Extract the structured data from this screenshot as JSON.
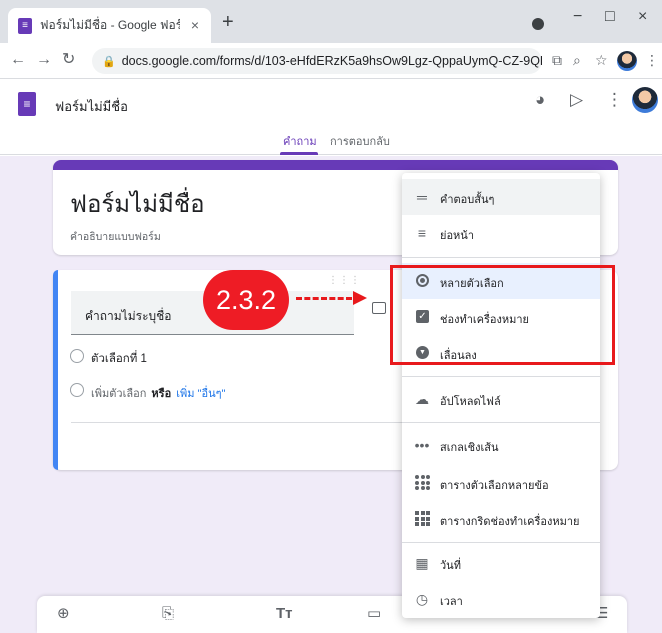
{
  "browser": {
    "tab_title": "ฟอร์มไม่มีชื่อ - Google ฟอร์ม",
    "tab_close": "×",
    "new_tab": "+",
    "url": "docs.google.com/forms/d/103-eHfdERzK5a9hsOw9Lgz-QppaUymQ-CZ-9QH9A...",
    "window_minimize": "−",
    "window_maximize": "□",
    "window_close": "×"
  },
  "app": {
    "form_name": "ฟอร์มไม่มีชื่อ",
    "tabs": [
      {
        "label": "คำถาม",
        "active": true
      },
      {
        "label": "การตอบกลับ",
        "active": false
      }
    ]
  },
  "form": {
    "title": "ฟอร์มไม่มีชื่อ",
    "description": "คำอธิบายแบบฟอร์ม"
  },
  "question": {
    "title": "คำถามไม่ระบุชื่อ",
    "option_1": "ตัวเลือกที่ 1",
    "add_option": "เพิ่มตัวเลือก",
    "or": "หรือ",
    "add_other": "เพิ่ม \"อื่นๆ\""
  },
  "menu": {
    "items": [
      {
        "label": "คำตอบสั้นๆ",
        "icon": "short-answer-icon"
      },
      {
        "label": "ย่อหน้า",
        "icon": "paragraph-icon"
      },
      {
        "label": "หลายตัวเลือก",
        "icon": "radio-icon"
      },
      {
        "label": "ช่องทำเครื่องหมาย",
        "icon": "checkbox-icon"
      },
      {
        "label": "เลื่อนลง",
        "icon": "dropdown-icon"
      },
      {
        "label": "อัปโหลดไฟล์",
        "icon": "cloud-upload-icon"
      },
      {
        "label": "สเกลเชิงเส้น",
        "icon": "linear-scale-icon"
      },
      {
        "label": "ตารางตัวเลือกหลายข้อ",
        "icon": "grid-icon"
      },
      {
        "label": "ตารางกริดช่องทำเครื่องหมาย",
        "icon": "checkbox-grid-icon"
      },
      {
        "label": "วันที่",
        "icon": "calendar-icon"
      },
      {
        "label": "เวลา",
        "icon": "clock-icon"
      }
    ]
  },
  "annotation": {
    "badge": "2.3.2",
    "color": "#e8191c"
  },
  "colors": {
    "accent": "#673ab7",
    "question_bar": "#4285f4",
    "background": "#f0ebf8"
  }
}
